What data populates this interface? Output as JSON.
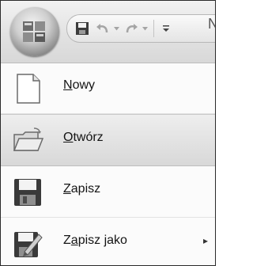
{
  "quick_access": {
    "tail_letter": "N"
  },
  "menu": {
    "items": [
      {
        "accel": "N",
        "rest": "owy",
        "icon": "new-document-icon"
      },
      {
        "accel": "O",
        "rest": "twórz",
        "icon": "open-folder-icon"
      },
      {
        "accel": "Z",
        "rest": "apisz",
        "icon": "save-disk-icon"
      },
      {
        "pre": "Z",
        "accel": "a",
        "rest": "pisz jako",
        "icon": "save-as-icon",
        "submenu_arrow": "▸"
      }
    ]
  }
}
